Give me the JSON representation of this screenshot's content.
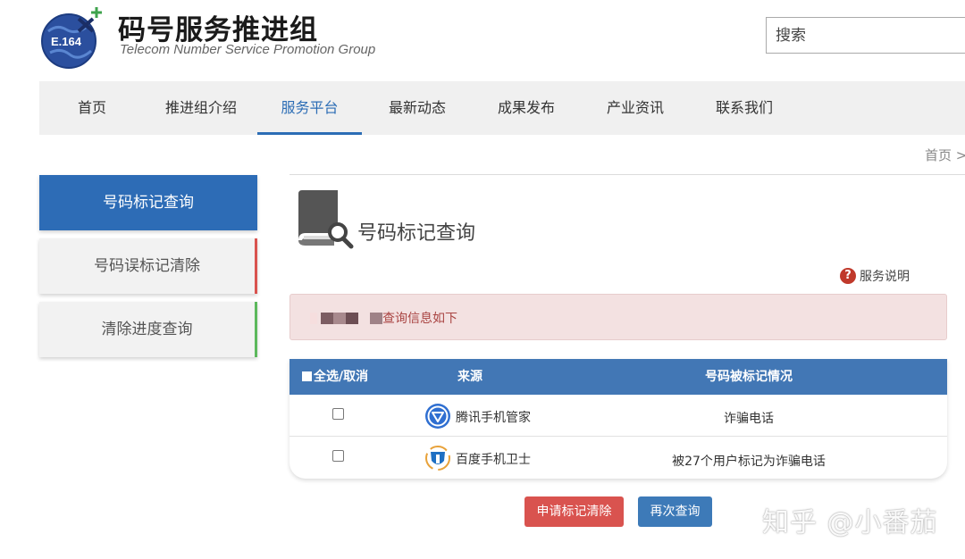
{
  "header": {
    "logo_text": "E.164",
    "site_title": "码号服务推进组",
    "site_subtitle": "Telecom Number Service  Promotion Group",
    "search_placeholder": "搜索"
  },
  "nav": [
    {
      "label": "首页"
    },
    {
      "label": "推进组介绍"
    },
    {
      "label": "服务平台",
      "active": true
    },
    {
      "label": "最新动态"
    },
    {
      "label": "成果发布"
    },
    {
      "label": "产业资讯"
    },
    {
      "label": "联系我们"
    }
  ],
  "breadcrumb": "首页 >",
  "sidebar": [
    {
      "label": "号码标记查询",
      "active": true
    },
    {
      "label": "号码误标记清除",
      "accent": "red"
    },
    {
      "label": "清除进度查询",
      "accent": "green"
    }
  ],
  "main": {
    "title": "号码标记查询",
    "help_label": "服务说明",
    "notice_text": "查询信息如下",
    "table": {
      "headers": [
        "全选/取消",
        "来源",
        "号码被标记情况"
      ],
      "rows": [
        {
          "source": "腾讯手机管家",
          "mark": "诈骗电话"
        },
        {
          "source": "百度手机卫士",
          "mark": "被27个用户标记为诈骗电话"
        }
      ]
    },
    "buttons": {
      "clear": "申请标记清除",
      "again": "再次查询"
    }
  },
  "watermark": "知乎 @小番茄",
  "colors": {
    "primary": "#2d6cb6",
    "danger": "#d9534f",
    "success": "#5cb85c",
    "notice_bg": "#f3e1e1"
  }
}
